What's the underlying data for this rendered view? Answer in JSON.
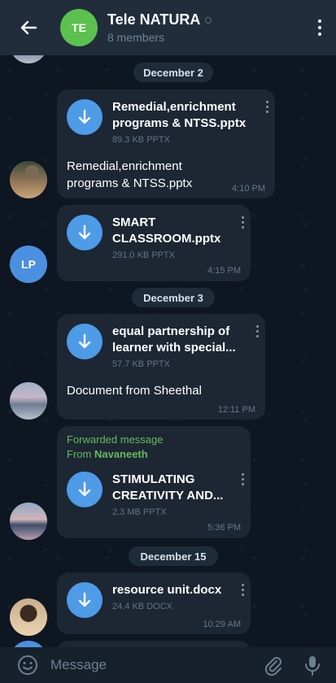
{
  "header": {
    "group_initials": "TE",
    "title": "Tele NATURA",
    "subtitle": "8 members",
    "colors": {
      "header_bg": "#212d3b",
      "avatar_bg": "#5cc14f"
    }
  },
  "dates": [
    "December 2",
    "December 3",
    "December 15"
  ],
  "messages": [
    {
      "file_name": "Remedial,enrichment programs & NTSS.pptx",
      "file_name_line1": "Remedial,enrichment",
      "file_name_line2": "programs & NTSS.pptx",
      "meta": "89.3 KB PPTX",
      "caption_line1": "Remedial,enrichment",
      "caption_line2": "programs & NTSS.pptx",
      "time": "4:10 PM"
    },
    {
      "sender_initials": "LP",
      "file_name_line1": "SMART",
      "file_name_line2": "CLASSROOM.pptx",
      "meta": "291.0 KB PPTX",
      "time": "4:15 PM"
    },
    {
      "file_name_line1": "equal partnership of",
      "file_name_line2": "learner with special...",
      "meta": "57.7 KB PPTX",
      "caption": "Document from Sheethal",
      "time": "12:11 PM"
    },
    {
      "forwarded_label": "Forwarded message",
      "from_prefix": "From ",
      "from_name": "Navaneeth",
      "file_name_line1": "STIMULATING",
      "file_name_line2": "CREATIVITY AND...",
      "meta": "2.3 MB PPTX",
      "time": "5:36 PM"
    },
    {
      "file_name_line1": "resource unit.docx",
      "meta": "24.4 KB DOCX",
      "time": "10:29 AM"
    }
  ],
  "composer": {
    "placeholder": "Message"
  },
  "icons": {
    "back": "back-arrow-icon",
    "menu": "more-vertical-icon",
    "download": "download-arrow-icon",
    "emoji": "emoji-icon",
    "attach": "paperclip-icon",
    "mic": "microphone-icon"
  }
}
